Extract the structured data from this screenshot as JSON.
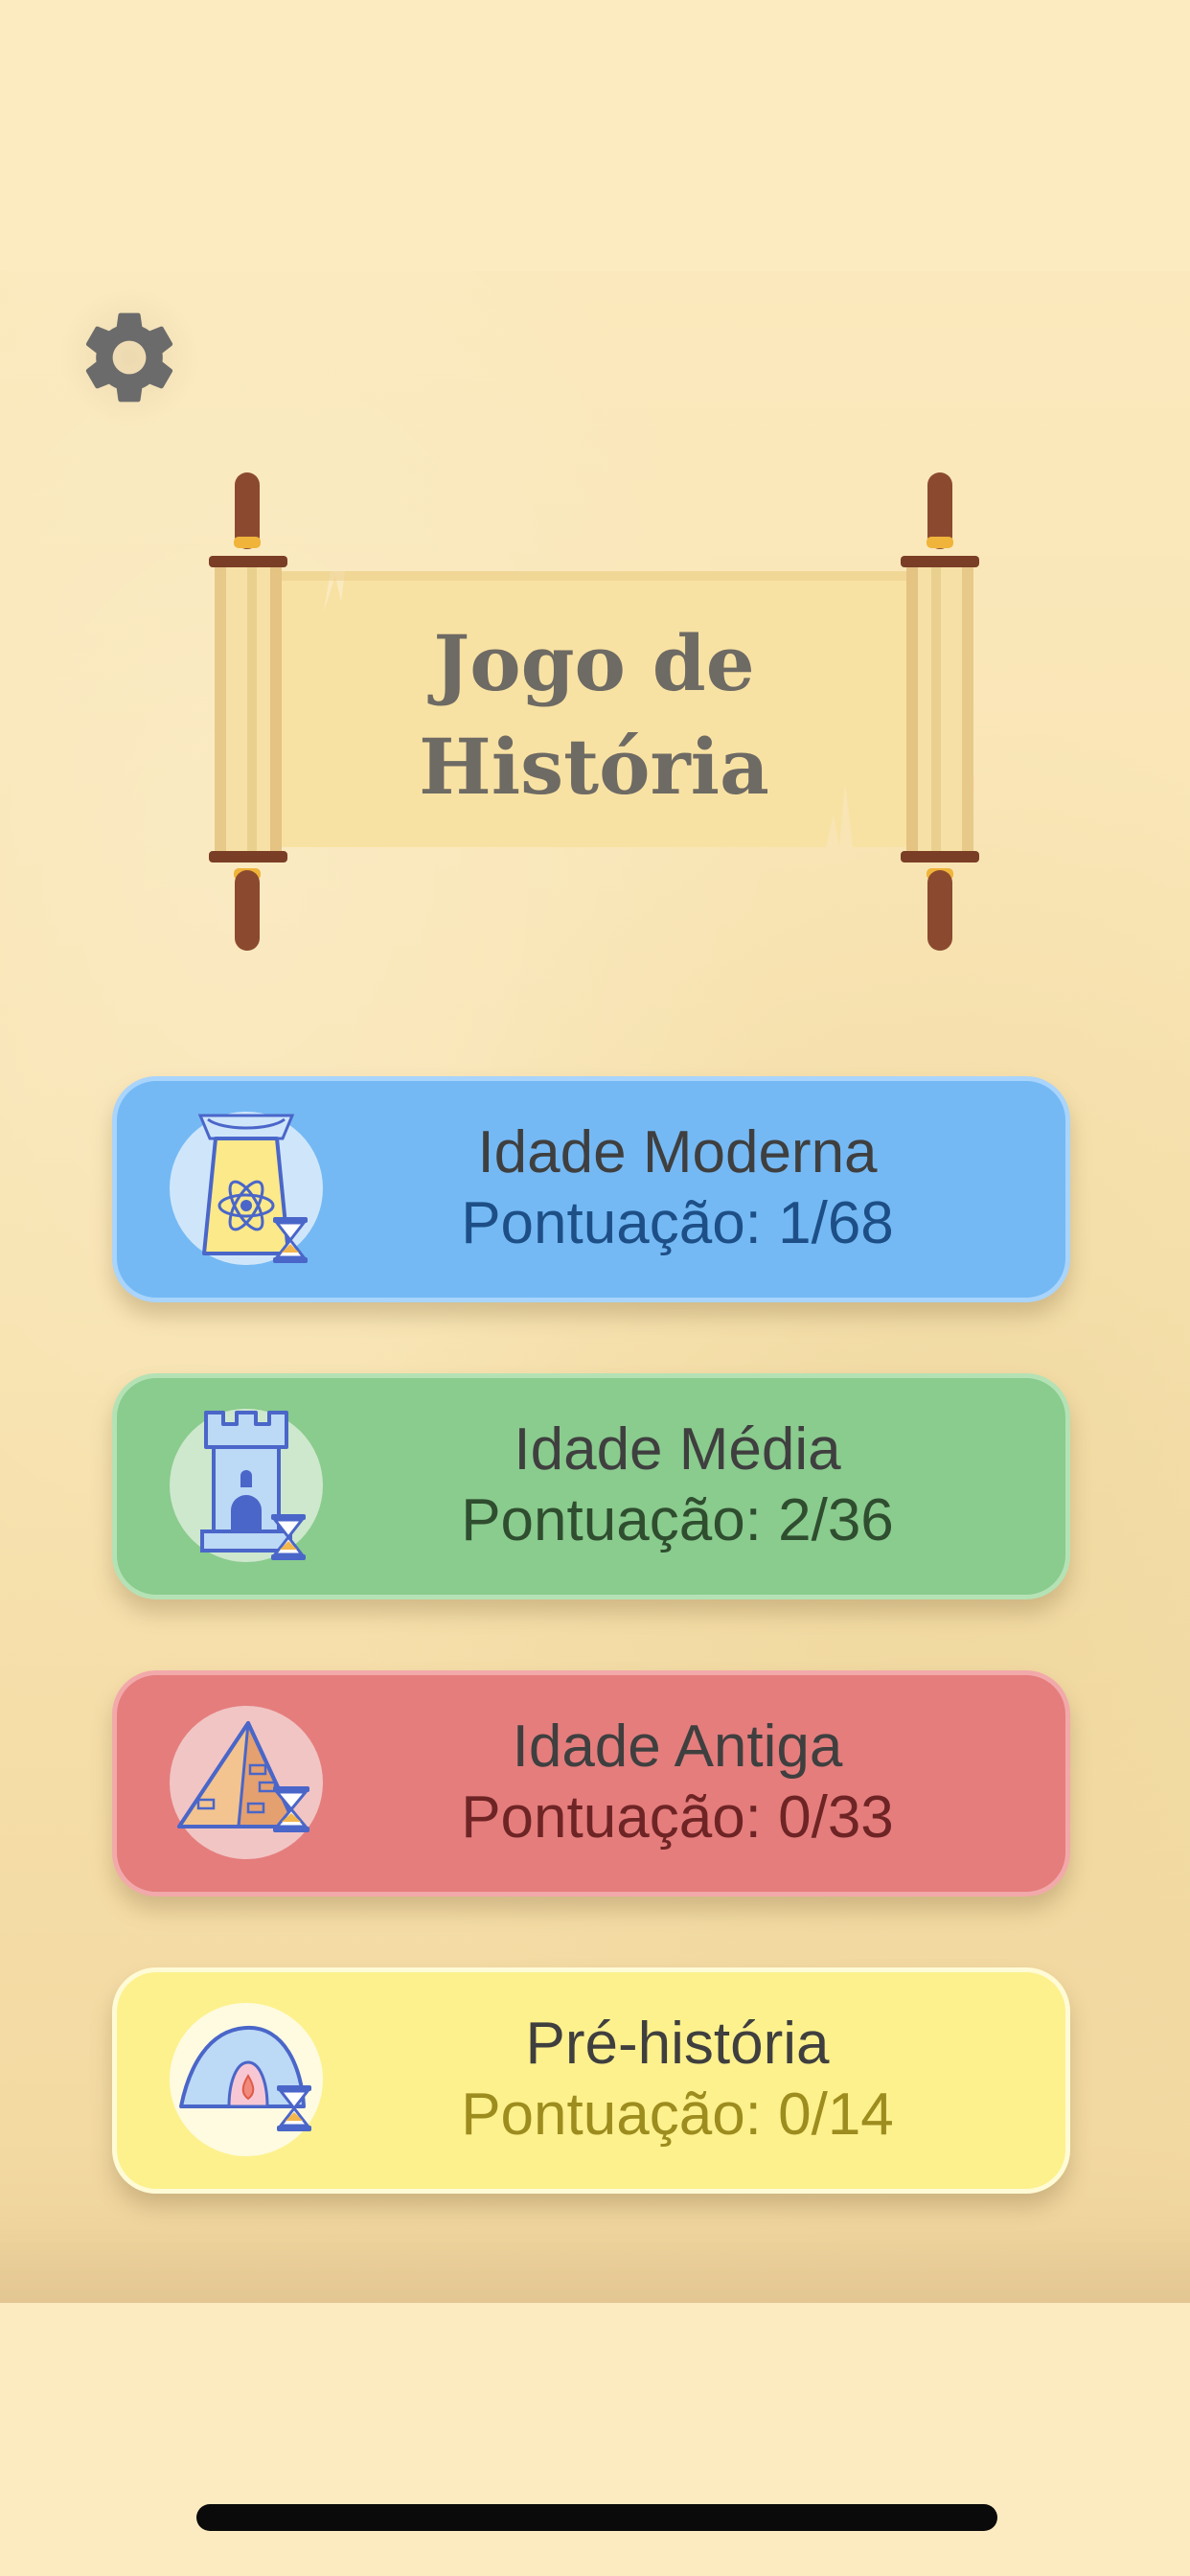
{
  "app": {
    "title_line1": "Jogo de",
    "title_line2": "História"
  },
  "settings": {
    "icon": "gear-icon"
  },
  "periods": [
    {
      "name": "Idade Moderna",
      "score": "Pontuação: 1/68",
      "icon": "modern-age-icon",
      "color": "#74b9f4"
    },
    {
      "name": "Idade Média",
      "score": "Pontuação: 2/36",
      "icon": "castle-tower-icon",
      "color": "#8acb8e"
    },
    {
      "name": "Idade Antiga",
      "score": "Pontuação: 0/33",
      "icon": "pyramid-icon",
      "color": "#e57d7d"
    },
    {
      "name": "Pré-história",
      "score": "Pontuação: 0/14",
      "icon": "cave-icon",
      "color": "#fdf18d"
    }
  ],
  "colors": {
    "background": "#fcebc0",
    "parchment": "#f8e3b0",
    "scroll_wood": "#8b4a2f",
    "scroll_gold": "#f0b43a"
  }
}
